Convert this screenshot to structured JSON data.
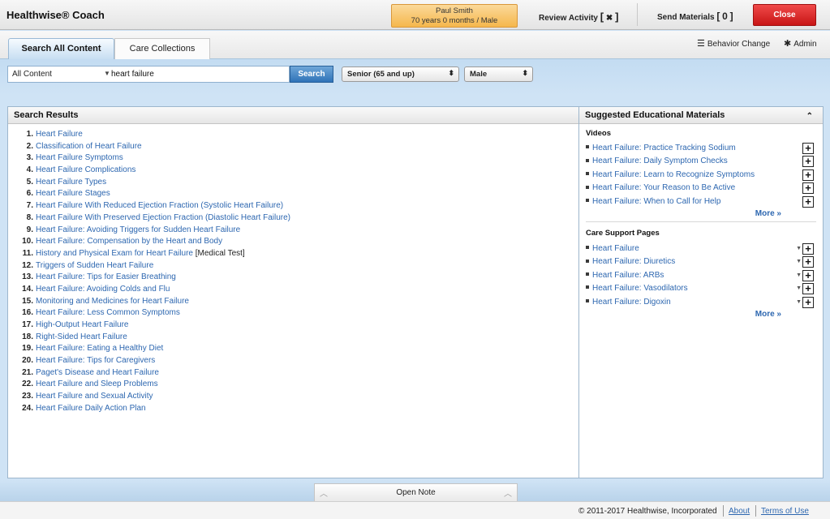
{
  "app": {
    "title": "Healthwise® Coach"
  },
  "patient": {
    "name": "Paul Smith",
    "details": "70 years 0 months / Male"
  },
  "topbar": {
    "review_label": "Review Activity",
    "review_value": "✖",
    "send_label": "Send Materials",
    "send_count": "0",
    "close_label": "Close"
  },
  "tabs": [
    {
      "label": "Search All Content",
      "active": true
    },
    {
      "label": "Care Collections",
      "active": false
    }
  ],
  "links": {
    "behavior_change": "Behavior Change",
    "admin": "Admin"
  },
  "search": {
    "category": "All Content",
    "query": "heart failure",
    "button": "Search",
    "age_filter": "Senior (65 and up)",
    "sex_filter": "Male"
  },
  "results": {
    "header": "Search Results",
    "items": [
      {
        "num": "1.",
        "title": "Heart Failure",
        "tag": ""
      },
      {
        "num": "2.",
        "title": "Classification of Heart Failure",
        "tag": ""
      },
      {
        "num": "3.",
        "title": "Heart Failure Symptoms",
        "tag": ""
      },
      {
        "num": "4.",
        "title": "Heart Failure Complications",
        "tag": ""
      },
      {
        "num": "5.",
        "title": "Heart Failure Types",
        "tag": ""
      },
      {
        "num": "6.",
        "title": "Heart Failure Stages",
        "tag": ""
      },
      {
        "num": "7.",
        "title": "Heart Failure With Reduced Ejection Fraction (Systolic Heart Failure)",
        "tag": ""
      },
      {
        "num": "8.",
        "title": "Heart Failure With Preserved Ejection Fraction (Diastolic Heart Failure)",
        "tag": ""
      },
      {
        "num": "9.",
        "title": "Heart Failure: Avoiding Triggers for Sudden Heart Failure",
        "tag": ""
      },
      {
        "num": "10.",
        "title": "Heart Failure: Compensation by the Heart and Body",
        "tag": ""
      },
      {
        "num": "11.",
        "title": "History and Physical Exam for Heart Failure",
        "tag": "[Medical Test]"
      },
      {
        "num": "12.",
        "title": "Triggers of Sudden Heart Failure",
        "tag": ""
      },
      {
        "num": "13.",
        "title": "Heart Failure: Tips for Easier Breathing",
        "tag": ""
      },
      {
        "num": "14.",
        "title": "Heart Failure: Avoiding Colds and Flu",
        "tag": ""
      },
      {
        "num": "15.",
        "title": "Monitoring and Medicines for Heart Failure",
        "tag": ""
      },
      {
        "num": "16.",
        "title": "Heart Failure: Less Common Symptoms",
        "tag": ""
      },
      {
        "num": "17.",
        "title": "High-Output Heart Failure",
        "tag": ""
      },
      {
        "num": "18.",
        "title": "Right-Sided Heart Failure",
        "tag": ""
      },
      {
        "num": "19.",
        "title": "Heart Failure: Eating a Healthy Diet",
        "tag": ""
      },
      {
        "num": "20.",
        "title": "Heart Failure: Tips for Caregivers",
        "tag": ""
      },
      {
        "num": "21.",
        "title": "Paget's Disease and Heart Failure",
        "tag": ""
      },
      {
        "num": "22.",
        "title": "Heart Failure and Sleep Problems",
        "tag": ""
      },
      {
        "num": "23.",
        "title": "Heart Failure and Sexual Activity",
        "tag": ""
      },
      {
        "num": "24.",
        "title": "Heart Failure Daily Action Plan",
        "tag": ""
      }
    ]
  },
  "suggested": {
    "header": "Suggested Educational Materials",
    "videos_label": "Videos",
    "videos": [
      "Heart Failure: Practice Tracking Sodium",
      "Heart Failure: Daily Symptom Checks",
      "Heart Failure: Learn to Recognize Symptoms",
      "Heart Failure: Your Reason to Be Active",
      "Heart Failure: When to Call for Help"
    ],
    "videos_more": "More »",
    "care_label": "Care Support Pages",
    "care_pages": [
      "Heart Failure",
      "Heart Failure: Diuretics",
      "Heart Failure: ARBs",
      "Heart Failure: Vasodilators",
      "Heart Failure: Digoxin"
    ],
    "care_more": "More »"
  },
  "open_note": "Open Note",
  "footer": {
    "copyright": "© 2011-2017 Healthwise, Incorporated",
    "about": "About",
    "terms": "Terms of Use"
  },
  "icons": {
    "behavior": "list-arrow-icon",
    "admin": "gear-icon",
    "plus": "plus-icon",
    "collapse": "chevron-up-icon"
  },
  "colors": {
    "link": "#2d67b0",
    "close": "#d81f1f",
    "patient_badge": "#f7c25f",
    "search_button": "#3a7dc0",
    "background": "#cfe3f5"
  }
}
